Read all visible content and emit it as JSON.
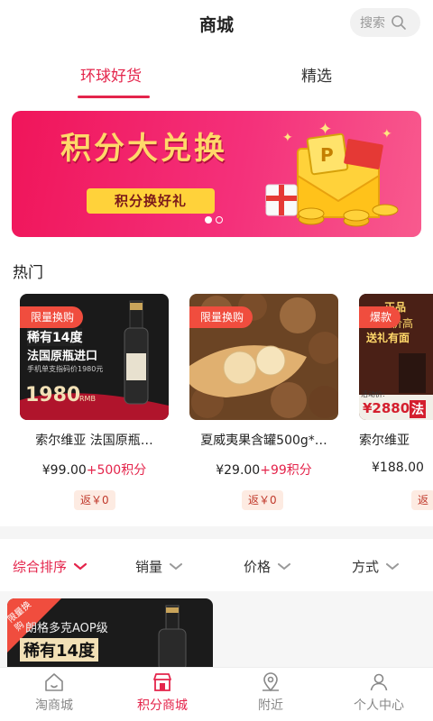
{
  "header": {
    "title": "商城",
    "search_label": "搜索"
  },
  "tabs": [
    {
      "label": "环球好货",
      "active": true
    },
    {
      "label": "精选",
      "active": false
    }
  ],
  "banner": {
    "headline": "积分大兑换",
    "cta": "积分换好礼",
    "slides": 2,
    "active_slide": 1
  },
  "hot": {
    "title": "热门",
    "items": [
      {
        "tag": "限量换购",
        "name": "索尔维亚 法国原瓶…",
        "cash": "¥99.00",
        "points": "+500积分",
        "rebate": "返￥0",
        "img_text": {
          "l1": "稀有14度",
          "l2": "法国原瓶进口",
          "l3": "手机单支指码价1980元",
          "l4": "1980",
          "l5": "RMB"
        }
      },
      {
        "tag": "限量换购",
        "name": "夏威夷果含罐500g*…",
        "cash": "¥29.00",
        "points": "+99积分",
        "rebate": "返￥0"
      },
      {
        "tag": "爆款",
        "name": "索尔维亚",
        "cash": "¥188.00",
        "points": "",
        "rebate": "返",
        "img_text": {
          "l1": "正品",
          "l2": "价高",
          "l3": "送礼有面",
          "l4": "活动价:",
          "l5": "¥2880",
          "l6": "法"
        }
      }
    ]
  },
  "sort": [
    {
      "label": "综合排序",
      "active": true
    },
    {
      "label": "销量",
      "active": false
    },
    {
      "label": "价格",
      "active": false
    },
    {
      "label": "方式",
      "active": false
    }
  ],
  "list_preview": {
    "tag": "限量换购",
    "l1": "朗格多克AOP级",
    "l2": "稀有14度"
  },
  "nav": [
    {
      "label": "淘商城",
      "active": false
    },
    {
      "label": "积分商城",
      "active": true
    },
    {
      "label": "附近",
      "active": false
    },
    {
      "label": "个人中心",
      "active": false
    }
  ],
  "colors": {
    "accent": "#e4244b",
    "tag": "#f04d3e",
    "banner_start": "#f0155a",
    "banner_end": "#f85a8e"
  }
}
